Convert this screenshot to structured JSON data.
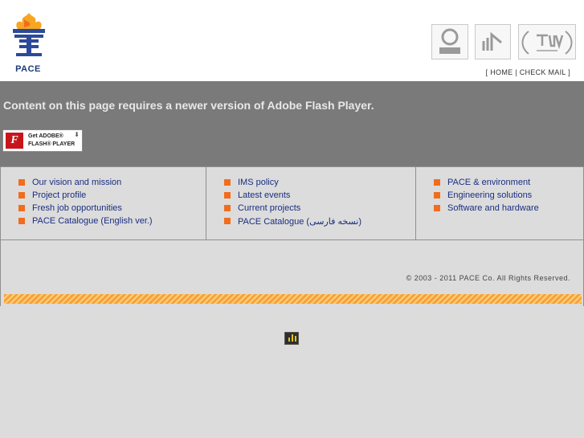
{
  "brand": {
    "logo_text": "PACE"
  },
  "certifications": [
    {
      "icon": "certification-badge-1-icon"
    },
    {
      "icon": "certification-badge-2-icon"
    },
    {
      "icon": "tuv-intercert-icon"
    }
  ],
  "top_links": {
    "open": "[",
    "home": "HOME",
    "sep": "|",
    "check_mail": "CHECK MAIL",
    "close": "]"
  },
  "flash": {
    "message": "Content on this page requires a newer version of Adobe Flash Player.",
    "button_line1": "Get ADOBE®",
    "button_line2": "FLASH® PLAYER",
    "button_icon": "F"
  },
  "menu": {
    "col1": [
      "Our vision and mission",
      "Project profile",
      "Fresh job opportunities",
      "PACE Catalogue (English ver.)"
    ],
    "col2": [
      "IMS policy",
      "Latest events",
      "Current projects",
      "PACE Catalogue (نسخه فارسی)"
    ],
    "col3": [
      "PACE & environment",
      "Engineering solutions",
      "Software and hardware"
    ]
  },
  "footer": {
    "copyright": "© 2003 - 2011 PACE Co. All Rights Reserved."
  },
  "colors": {
    "accent": "#f26c1d",
    "link": "#1a2e80",
    "flash_bg": "#7a7a7a",
    "page_bg": "#dcdcdc"
  }
}
